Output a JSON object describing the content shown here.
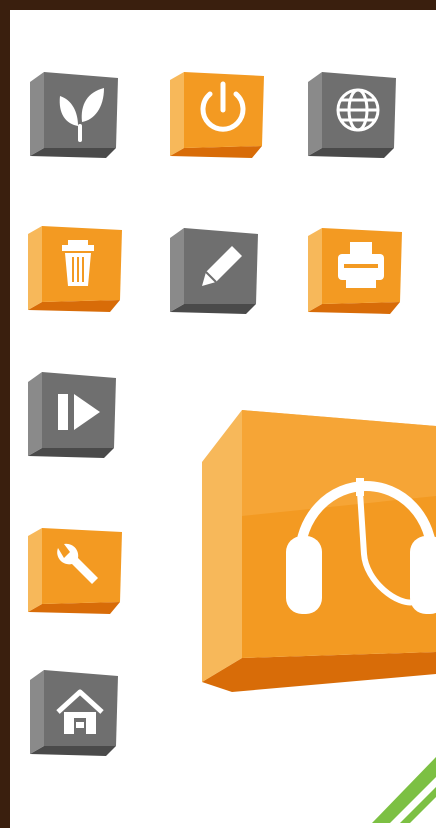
{
  "colors": {
    "frame": "#3a1f0e",
    "background": "#ffffff",
    "orange_face": "#f39a22",
    "orange_side": "#e07a10",
    "orange_top": "#f7b85a",
    "gray_face": "#6f6f6f",
    "gray_side": "#4a4a4a",
    "gray_top": "#a9a9a9",
    "green_stripe": "#7cc043"
  },
  "icons": [
    {
      "name": "leaf-icon",
      "color": "gray"
    },
    {
      "name": "power-icon",
      "color": "orange"
    },
    {
      "name": "globe-icon",
      "color": "gray"
    },
    {
      "name": "trash-icon",
      "color": "orange"
    },
    {
      "name": "pencil-icon",
      "color": "gray"
    },
    {
      "name": "printer-icon",
      "color": "orange"
    },
    {
      "name": "play-pause-icon",
      "color": "gray"
    },
    {
      "name": "wrench-icon",
      "color": "orange"
    },
    {
      "name": "home-icon",
      "color": "gray"
    },
    {
      "name": "headphones-icon",
      "color": "orange"
    }
  ]
}
